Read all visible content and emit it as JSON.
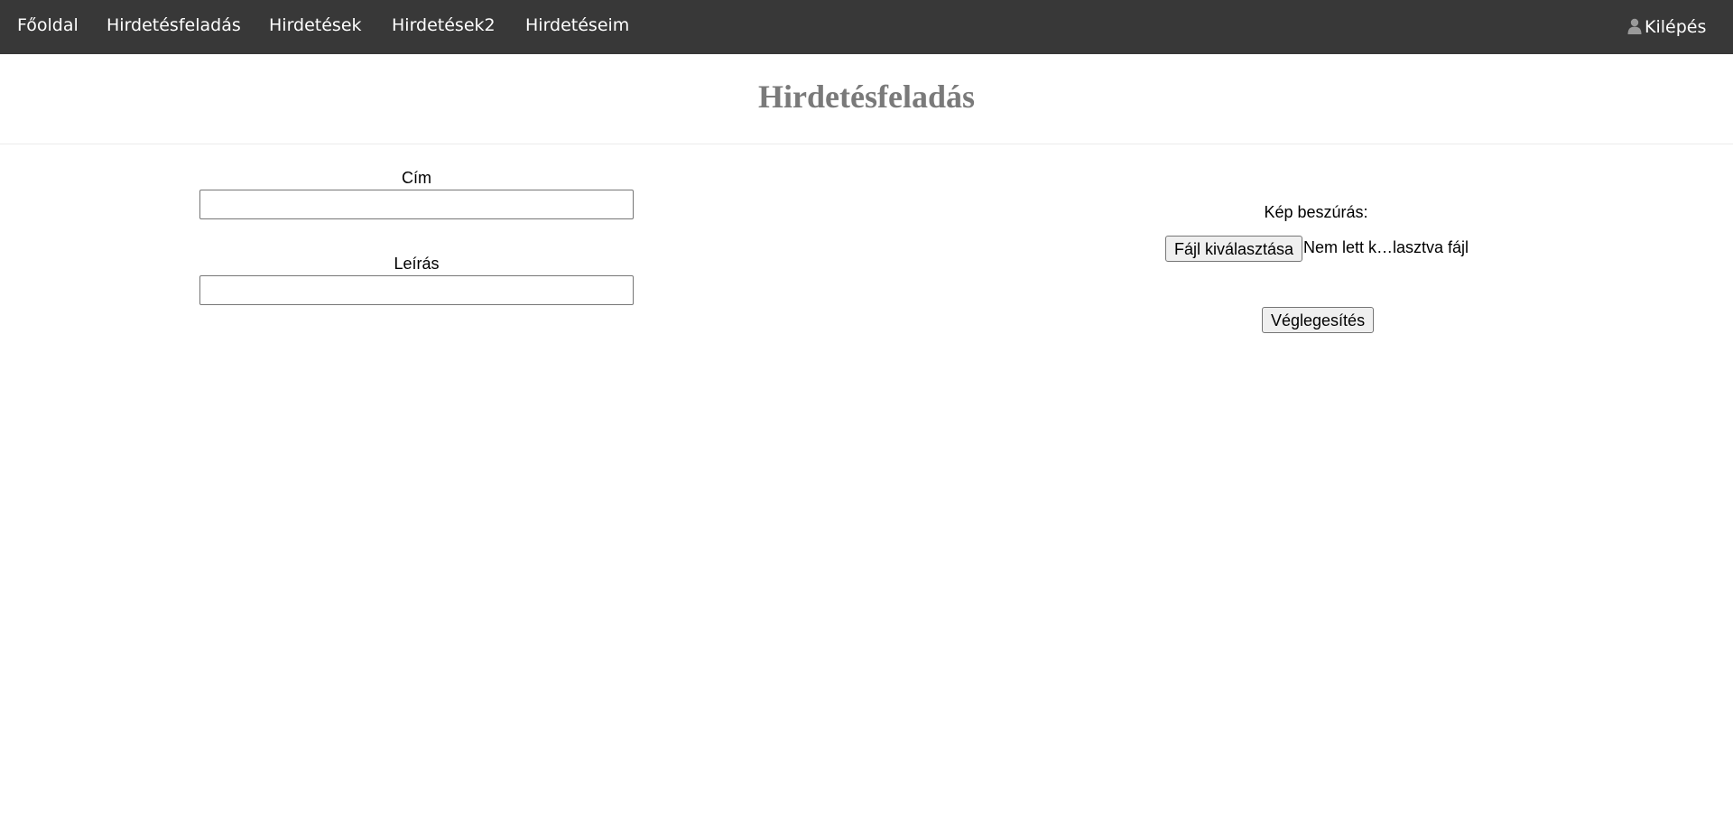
{
  "nav": {
    "items": [
      {
        "label": "Főoldal"
      },
      {
        "label": "Hirdetésfeladás"
      },
      {
        "label": "Hirdetések"
      },
      {
        "label": "Hirdetések2"
      },
      {
        "label": "Hirdetéseim"
      }
    ],
    "logout_label": "Kilépés",
    "logout_icon": "user-icon"
  },
  "page": {
    "title": "Hirdetésfeladás"
  },
  "form": {
    "title_label": "Cím",
    "title_value": "",
    "description_label": "Leírás",
    "description_value": "",
    "image_label": "Kép beszúrás:",
    "file_button_label": "Fájl kiválasztása",
    "file_status": "Nem lett k…lasztva fájl",
    "submit_label": "Véglegesítés"
  },
  "colors": {
    "navbar_bg": "#383838",
    "nav_text": "#ffffff",
    "title_text": "#7a7a7a"
  }
}
